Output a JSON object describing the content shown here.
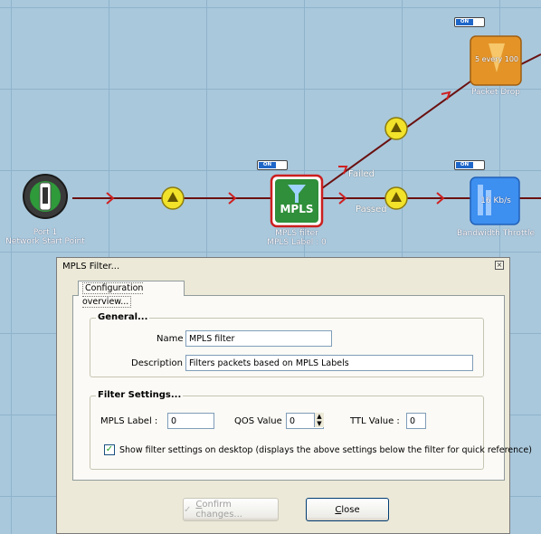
{
  "canvas": {
    "nodes": {
      "port": {
        "line1": "Port 1",
        "line2": "Network Start Point"
      },
      "mpls": {
        "icon_text": "MPLS",
        "line1": "MPLS filter",
        "line2": "MPLS Label : 0"
      },
      "drop": {
        "icon_text": "5 every 100",
        "label": "Packet Drop"
      },
      "throttle": {
        "icon_text": "16 Kb/s",
        "label": "Bandwidth Throttle"
      }
    },
    "toggles": {
      "on_label": "ON"
    },
    "edges": {
      "failed": "Failed",
      "passed": "Passed"
    },
    "colors": {
      "edge": "#7a1010",
      "arrow": "#d02020",
      "grid_bg": "#a9c8dc",
      "accent_green": "#2f8f3a"
    }
  },
  "dialog": {
    "title": "MPLS Filter...",
    "tab_label": "Configuration overview...",
    "general": {
      "title": "General...",
      "name_label": "Name :",
      "name_value": "MPLS filter",
      "description_label": "Description :",
      "description_value": "Filters packets based on MPLS Labels"
    },
    "filter": {
      "title": "Filter Settings...",
      "mpls_label": "MPLS Label :",
      "mpls_value": "0",
      "qos_label": "QOS Value :",
      "qos_value": "0",
      "ttl_label": "TTL Value :",
      "ttl_value": "0",
      "show_checkbox_label": "Show filter settings on desktop (displays the above settings below the filter for quick reference)",
      "show_checked": true
    },
    "buttons": {
      "confirm_prefix": "",
      "confirm_ul": "C",
      "confirm_rest": "onfirm changes...",
      "close_ul": "C",
      "close_rest": "lose"
    }
  }
}
